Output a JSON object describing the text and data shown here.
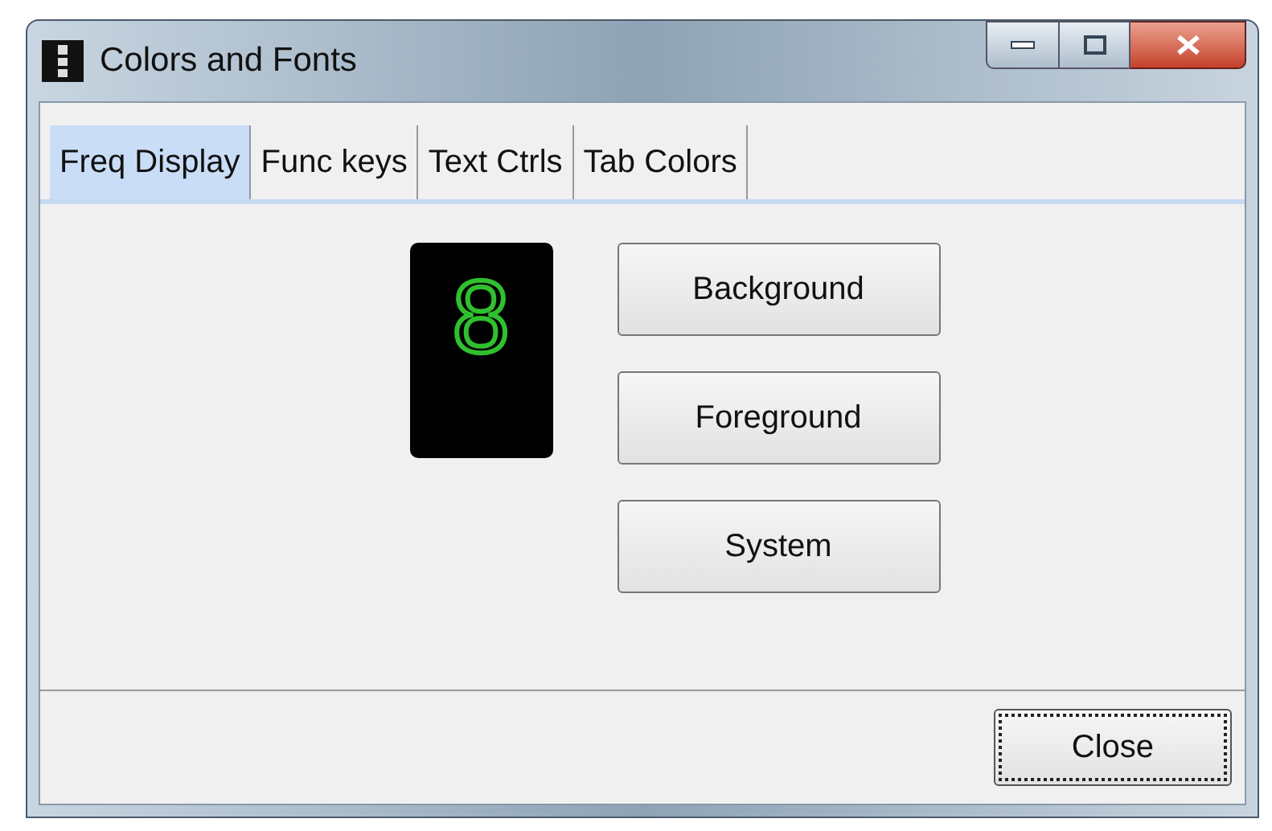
{
  "window": {
    "title": "Colors and Fonts"
  },
  "tabs": [
    {
      "label": "Freq Display",
      "selected": true
    },
    {
      "label": "Func keys",
      "selected": false
    },
    {
      "label": "Text Ctrls",
      "selected": false
    },
    {
      "label": "Tab Colors",
      "selected": false
    }
  ],
  "display": {
    "digit": "8"
  },
  "buttons": [
    "Background",
    "Foreground",
    "System"
  ],
  "close_button": {
    "label": "Close",
    "focused": true
  }
}
